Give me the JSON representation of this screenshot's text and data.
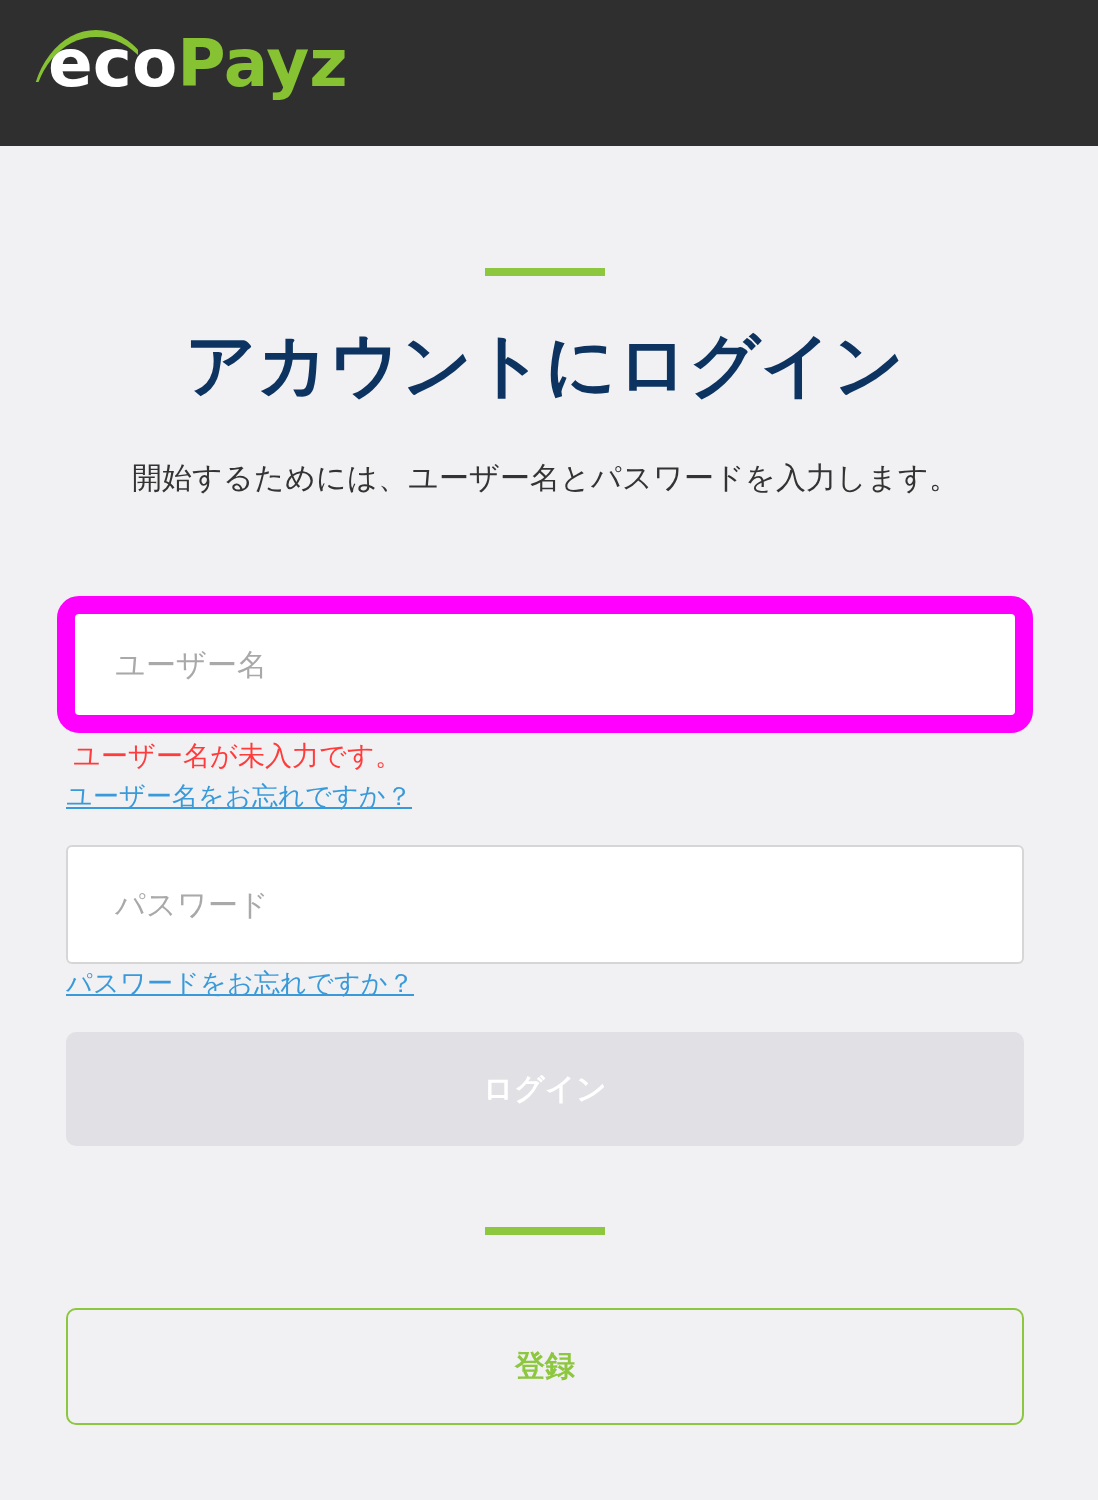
{
  "header": {
    "logo": {
      "primary": "eco",
      "accent": "Payz"
    }
  },
  "title": "アカウントにログイン",
  "subtitle": "開始するためには、ユーザー名とパスワードを入力します。",
  "fields": [
    {
      "placeholder": "ユーザー名",
      "highlighted": true,
      "error": "ユーザー名が未入力です。",
      "link": "ユーザー名をお忘れですか？"
    },
    {
      "placeholder": "パスワード",
      "highlighted": false,
      "link": "パスワードをお忘れですか？"
    }
  ],
  "login_button": {
    "label": "ログイン",
    "disabled": true
  },
  "register_button": {
    "label": "登録"
  }
}
